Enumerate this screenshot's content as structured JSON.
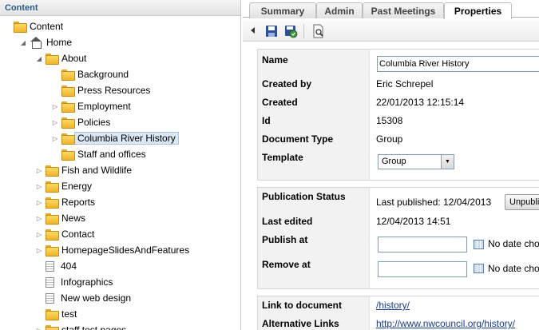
{
  "tree": {
    "header": "Content",
    "nodes": [
      {
        "label": "Content",
        "icon": "folder-icon",
        "indent": 0,
        "expander": "none"
      },
      {
        "label": "Home",
        "icon": "home-icon",
        "indent": 1,
        "expander": "expanded"
      },
      {
        "label": "About",
        "icon": "folder-icon",
        "indent": 2,
        "expander": "expanded"
      },
      {
        "label": "Background",
        "icon": "folder-icon",
        "indent": 3,
        "expander": "none"
      },
      {
        "label": "Press Resources",
        "icon": "folder-icon",
        "indent": 3,
        "expander": "none"
      },
      {
        "label": "Employment",
        "icon": "folder-icon",
        "indent": 3,
        "expander": "collapsed"
      },
      {
        "label": "Policies",
        "icon": "folder-icon",
        "indent": 3,
        "expander": "collapsed"
      },
      {
        "label": "Columbia River History",
        "icon": "folder-icon",
        "indent": 3,
        "expander": "collapsed",
        "selected": true
      },
      {
        "label": "Staff and offices",
        "icon": "folder-icon",
        "indent": 3,
        "expander": "none"
      },
      {
        "label": "Fish and Wildlife",
        "icon": "folder-icon",
        "indent": 2,
        "expander": "collapsed"
      },
      {
        "label": "Energy",
        "icon": "folder-icon",
        "indent": 2,
        "expander": "collapsed"
      },
      {
        "label": "Reports",
        "icon": "folder-icon",
        "indent": 2,
        "expander": "collapsed"
      },
      {
        "label": "News",
        "icon": "folder-icon",
        "indent": 2,
        "expander": "collapsed"
      },
      {
        "label": "Contact",
        "icon": "folder-icon",
        "indent": 2,
        "expander": "collapsed"
      },
      {
        "label": "HomepageSlidesAndFeatures",
        "icon": "folder-icon",
        "indent": 2,
        "expander": "collapsed"
      },
      {
        "label": "404",
        "icon": "document-icon",
        "indent": 2,
        "expander": "none"
      },
      {
        "label": "Infographics",
        "icon": "document-icon",
        "indent": 2,
        "expander": "none"
      },
      {
        "label": "New web design",
        "icon": "document-icon",
        "indent": 2,
        "expander": "none"
      },
      {
        "label": "test",
        "icon": "folder-icon",
        "indent": 2,
        "expander": "none"
      },
      {
        "label": "staff test pages",
        "icon": "folder-icon",
        "indent": 2,
        "expander": "collapsed"
      }
    ]
  },
  "tabs": [
    {
      "label": "Summary"
    },
    {
      "label": "Admin"
    },
    {
      "label": "Past Meetings"
    },
    {
      "label": "Properties",
      "active": true
    }
  ],
  "toolbar": {
    "icons": [
      "collapse-arrow-icon",
      "save-icon",
      "save-and-publish-icon",
      "preview-icon"
    ]
  },
  "properties": {
    "name_label": "Name",
    "name_value": "Columbia River History",
    "created_by_label": "Created by",
    "created_by_value": "Eric Schrepel",
    "created_label": "Created",
    "created_value": "22/01/2013 12:15:14",
    "id_label": "Id",
    "id_value": "15308",
    "doctype_label": "Document Type",
    "doctype_value": "Group",
    "template_label": "Template",
    "template_value": "Group"
  },
  "publication": {
    "status_label": "Publication Status",
    "last_published": "Last published:  12/04/2013",
    "unpublish_button": "Unpublish",
    "last_edited_label": "Last edited",
    "last_edited_value": "12/04/2013 14:51",
    "publish_at_label": "Publish at",
    "publish_at_value": "",
    "publish_no_date": "No date chosen",
    "remove_at_label": "Remove at",
    "remove_at_value": "",
    "remove_no_date": "No date chosen"
  },
  "links": {
    "link_label": "Link to document",
    "link_value": "/history/",
    "alt_label": "Alternative Links",
    "alt_value": "http://www.nwcouncil.org/history/"
  },
  "colors": {
    "link": "#1a3c8e",
    "header_text": "#2a5a8a",
    "selection": "#dbe7f5"
  }
}
